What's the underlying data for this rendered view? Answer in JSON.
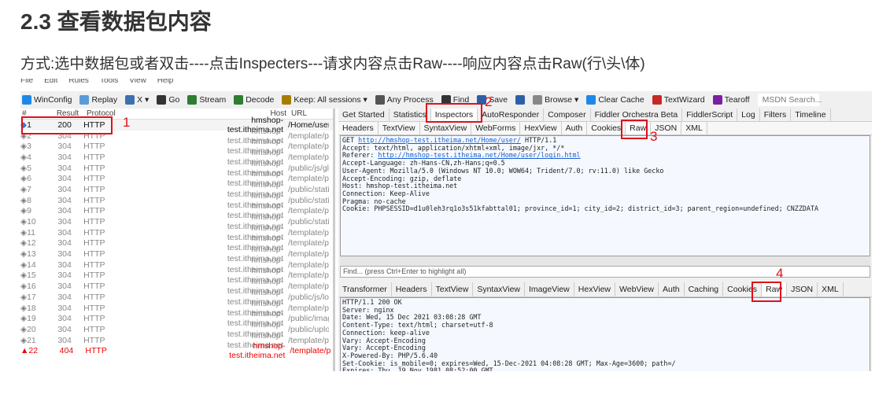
{
  "heading": "2.3 查看数据包内容",
  "subtitle": "方式:选中数据包或者双击----点击Inspecters---请求内容点击Raw----响应内容点击Raw(行\\头\\体)",
  "menu": [
    "File",
    "Edit",
    "Rules",
    "Tools",
    "View",
    "Help"
  ],
  "toolbar": [
    "WinConfig",
    "Replay",
    "X ▾",
    "Go",
    "Stream",
    "Decode",
    "Keep: All sessions ▾",
    "Any Process",
    "Find",
    "Save",
    "",
    "Browse ▾",
    "Clear Cache",
    "TextWizard",
    "Tearoff"
  ],
  "toolbar_search": "MSDN Search...",
  "session_columns": [
    "#",
    "Result",
    "Protocol",
    "Host",
    "URL"
  ],
  "sessions": [
    [
      "1",
      "200",
      "HTTP",
      "hmshop-test.itheima.net",
      "/Home/user/"
    ],
    [
      "2",
      "304",
      "HTTP",
      "hmshop-test.itheima.net",
      "/template/pc/r"
    ],
    [
      "3",
      "304",
      "HTTP",
      "hmshop-test.itheima.net",
      "/template/pc/r"
    ],
    [
      "4",
      "304",
      "HTTP",
      "hmshop-test.itheima.net",
      "/template/pc/r"
    ],
    [
      "5",
      "304",
      "HTTP",
      "hmshop-test.itheima.net",
      "/public/js/globa"
    ],
    [
      "6",
      "304",
      "HTTP",
      "hmshop-test.itheima.net",
      "/template/pc/r"
    ],
    [
      "7",
      "304",
      "HTTP",
      "hmshop-test.itheima.net",
      "/public/static/js"
    ],
    [
      "8",
      "304",
      "HTTP",
      "hmshop-test.itheima.net",
      "/public/static/js"
    ],
    [
      "9",
      "304",
      "HTTP",
      "hmshop-test.itheima.net",
      "/template/pc/r"
    ],
    [
      "10",
      "304",
      "HTTP",
      "hmshop-test.itheima.net",
      "/public/static/ir"
    ],
    [
      "11",
      "304",
      "HTTP",
      "hmshop-test.itheima.net",
      "/template/pc/r"
    ],
    [
      "12",
      "304",
      "HTTP",
      "hmshop-test.itheima.net",
      "/template/pc/r"
    ],
    [
      "13",
      "304",
      "HTTP",
      "hmshop-test.itheima.net",
      "/template/pc/r"
    ],
    [
      "14",
      "304",
      "HTTP",
      "hmshop-test.itheima.net",
      "/template/pc/r"
    ],
    [
      "15",
      "304",
      "HTTP",
      "hmshop-test.itheima.net",
      "/template/pc/r"
    ],
    [
      "16",
      "304",
      "HTTP",
      "hmshop-test.itheima.net",
      "/template/pc/r"
    ],
    [
      "17",
      "304",
      "HTTP",
      "hmshop-test.itheima.net",
      "/public/js/locat"
    ],
    [
      "18",
      "304",
      "HTTP",
      "hmshop-test.itheima.net",
      "/template/pc/r"
    ],
    [
      "19",
      "304",
      "HTTP",
      "hmshop-test.itheima.net",
      "/public/images"
    ],
    [
      "20",
      "304",
      "HTTP",
      "hmshop-test.itheima.net",
      "/public/upload/"
    ],
    [
      "21",
      "304",
      "HTTP",
      "hmshop-test.itheima.net",
      "/template/pc/r"
    ],
    [
      "22",
      "404",
      "HTTP",
      "hmshop-test.itheima.net",
      "/template/pc/r"
    ]
  ],
  "main_tabs": [
    "Get Started",
    "Statistics",
    "Inspectors",
    "AutoResponder",
    "Composer",
    "Fiddler Orchestra Beta",
    "FiddlerScript",
    "Log",
    "Filters",
    "Timeline"
  ],
  "request_tabs": [
    "Headers",
    "TextView",
    "SyntaxView",
    "WebForms",
    "HexView",
    "Auth",
    "Cookies",
    "Raw",
    "JSON",
    "XML"
  ],
  "request_raw": {
    "line1_method": "GET ",
    "line1_url": "http://hmshop-test.itheima.net/Home/user/",
    "line1_rest": " HTTP/1.1",
    "accept": "Accept: text/html, application/xhtml+xml, image/jxr, */*",
    "referer_label": "Referer: ",
    "referer_url": "http://hmshop-test.itheima.net/Home/user/login.html",
    "rest": "Accept-Language: zh-Hans-CN,zh-Hans;q=0.5\nUser-Agent: Mozilla/5.0 (Windows NT 10.0; WOW64; Trident/7.0; rv:11.0) like Gecko\nAccept-Encoding: gzip, deflate\nHost: hmshop-test.itheima.net\nConnection: Keep-Alive\nPragma: no-cache\nCookie: PHPSESSID=d1u0leh3rq1o3s51kfabttal01; province_id=1; city_id=2; district_id=3; parent_region=undefined; CNZZDATA"
  },
  "find_placeholder": "Find... (press Ctrl+Enter to highlight all)",
  "response_tabs": [
    "Transformer",
    "Headers",
    "TextView",
    "SyntaxView",
    "ImageView",
    "HexView",
    "WebView",
    "Auth",
    "Caching",
    "Cookies",
    "Raw",
    "JSON",
    "XML"
  ],
  "response_raw": "HTTP/1.1 200 OK\nServer: nginx\nDate: Wed, 15 Dec 2021 03:08:28 GMT\nContent-Type: text/html; charset=utf-8\nConnection: keep-alive\nVary: Accept-Encoding\nVary: Accept-Encoding\nX-Powered-By: PHP/5.6.40\nSet-Cookie: is_mobile=0; expires=Wed, 15-Dec-2021 04:08:28 GMT; Max-Age=3600; path=/\nExpires: Thu, 19 Nov 1981 08:52:00 GMT",
  "annotations": [
    "1",
    "2",
    "3",
    "4"
  ],
  "colors": {
    "annotation": "#e0101a",
    "error_row": "#e00000",
    "link": "#1a5fd0"
  }
}
